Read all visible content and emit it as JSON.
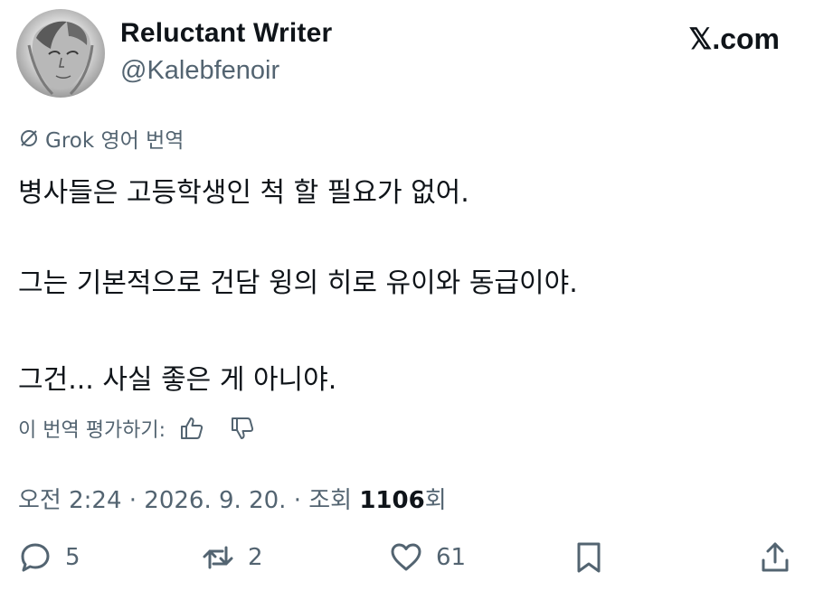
{
  "author": {
    "name": "Reluctant Writer",
    "handle": "@Kalebfenoir"
  },
  "brand": "𝕏.com",
  "translation": {
    "label": "Grok 영어 번역"
  },
  "tweet": {
    "lines": [
      "병사들은 고등학생인 척 할 필요가 없어.",
      "그는 기본적으로 건담 윙의 히로 유이와 동급이야.",
      "그건... 사실 좋은 게 아니야."
    ]
  },
  "rating": {
    "prompt": "이 번역 평가하기:"
  },
  "meta": {
    "time": "오전 2:24",
    "separator": "·",
    "date": "2026. 9. 20.",
    "views_prefix": "조회",
    "views_count": "1106",
    "views_suffix": "회"
  },
  "actions": {
    "reply_count": "5",
    "repost_count": "2",
    "like_count": "61"
  },
  "colors": {
    "text": "#0f1419",
    "secondary": "#536471"
  }
}
